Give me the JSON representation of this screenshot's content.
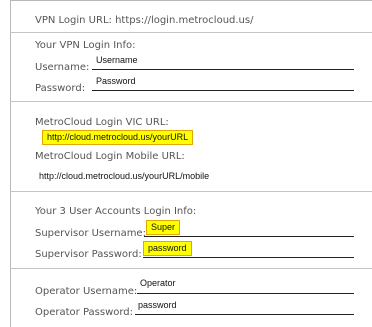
{
  "vpn": {
    "url_label": "VPN Login URL:",
    "url": "https://login.metrocloud.us/",
    "info_heading": "Your VPN Login Info:",
    "username_label": "Username:",
    "username_value": "Username",
    "password_label": "Password:",
    "password_value": "Password"
  },
  "metrocloud": {
    "vic_label": "MetroCloud Login VIC URL:",
    "vic_url": "http://cloud.metrocloud.us/yourURL",
    "mobile_label": "MetroCloud Login Mobile URL:",
    "mobile_url": "http://cloud.metrocloud.us/yourURL/mobile"
  },
  "user_accounts": {
    "heading": "Your 3 User Accounts Login Info:",
    "supervisor_username_label": "Supervisor Username:",
    "supervisor_username_value": "Super",
    "supervisor_password_label": "Supervisor Password:",
    "supervisor_password_value": "password",
    "operator_username_label": "Operator Username:",
    "operator_username_value": "Operator",
    "operator_password_label": "Operator Password:",
    "operator_password_value": "password"
  },
  "colors": {
    "highlight": "#ffff00",
    "highlight_border": "#e0a800"
  }
}
